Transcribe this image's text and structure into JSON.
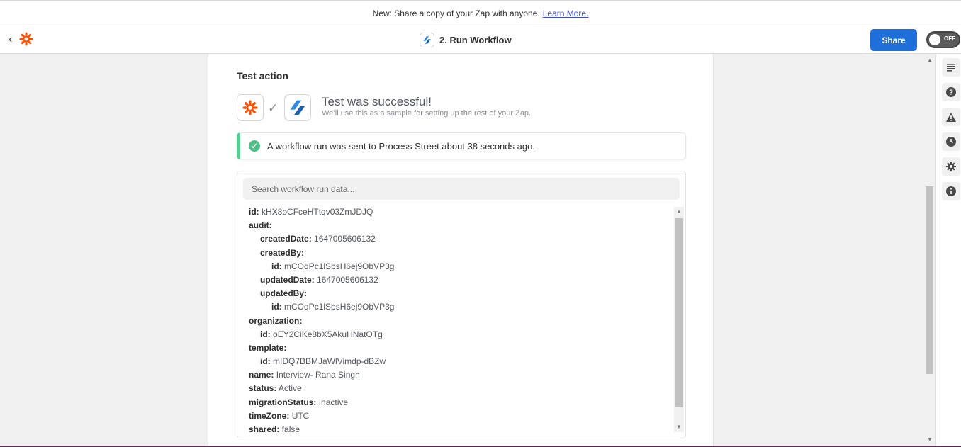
{
  "banner": {
    "text": "New: Share a copy of your Zap with anyone.",
    "link": "Learn More."
  },
  "header": {
    "title": "2. Run Workflow",
    "share_label": "Share",
    "toggle_label": "OFF"
  },
  "section": {
    "title": "Test action",
    "success_title": "Test was successful!",
    "success_subtitle": "We’ll use this as a sample for setting up the rest of your Zap."
  },
  "alert": {
    "text": "A workflow run was sent to Process Street about 38 seconds ago."
  },
  "search": {
    "placeholder": "Search workflow run data..."
  },
  "data_rows": [
    {
      "key": "id:",
      "value": "kHX8oCFceHTtqv03ZmJDJQ",
      "indent": 0
    },
    {
      "key": "audit:",
      "value": "",
      "indent": 0
    },
    {
      "key": "createdDate:",
      "value": "1647005606132",
      "indent": 1
    },
    {
      "key": "createdBy:",
      "value": "",
      "indent": 1
    },
    {
      "key": "id:",
      "value": "mCOqPc1lSbsH6ej9ObVP3g",
      "indent": 2
    },
    {
      "key": "updatedDate:",
      "value": "1647005606132",
      "indent": 1
    },
    {
      "key": "updatedBy:",
      "value": "",
      "indent": 1
    },
    {
      "key": "id:",
      "value": "mCOqPc1lSbsH6ej9ObVP3g",
      "indent": 2
    },
    {
      "key": "organization:",
      "value": "",
      "indent": 0
    },
    {
      "key": "id:",
      "value": "oEY2CiKe8bX5AkuHNatOTg",
      "indent": 1
    },
    {
      "key": "template:",
      "value": "",
      "indent": 0
    },
    {
      "key": "id:",
      "value": "mIDQ7BBMJaWlVimdp-dBZw",
      "indent": 1
    },
    {
      "key": "name:",
      "value": "Interview- Rana Singh",
      "indent": 0
    },
    {
      "key": "status:",
      "value": "Active",
      "indent": 0
    },
    {
      "key": "migrationStatus:",
      "value": "Inactive",
      "indent": 0
    },
    {
      "key": "timeZone:",
      "value": "UTC",
      "indent": 0
    },
    {
      "key": "shared:",
      "value": "false",
      "indent": 0
    }
  ],
  "rail_icons": [
    "list-icon",
    "help-icon",
    "warning-icon",
    "clock-icon",
    "settings-icon",
    "info-icon"
  ],
  "colors": {
    "primary": "#1f6fdb",
    "zapier_orange": "#ff4f00",
    "success": "#4fbf88",
    "process_street_blue": "#2a8ae3"
  }
}
